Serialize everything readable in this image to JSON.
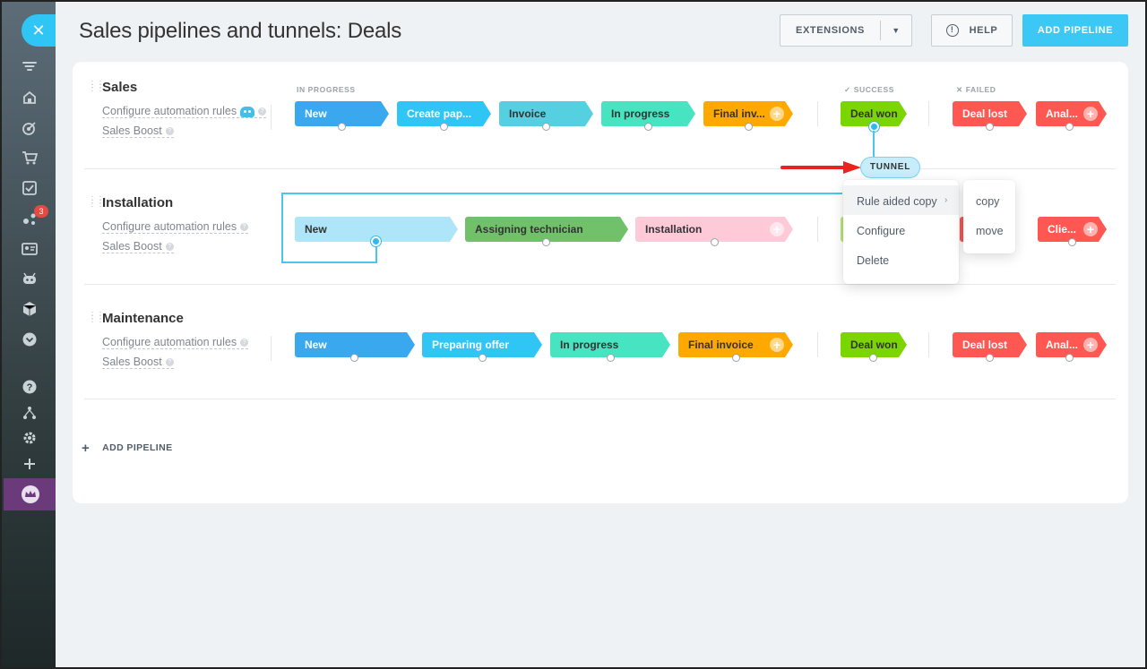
{
  "page": {
    "title": "Sales pipelines and tunnels: Deals"
  },
  "header": {
    "extensions_label": "EXTENSIONS",
    "help_label": "HELP",
    "add_pipeline_label": "ADD PIPELINE"
  },
  "sidebar": {
    "close_glyph": "✕",
    "badge_count": "3",
    "icons": [
      "filter-icon",
      "home-icon",
      "target-icon",
      "cart-icon",
      "checklist-icon",
      "network-icon",
      "contact-card-icon",
      "robot-icon",
      "box-icon",
      "chevron-down-icon",
      "help-icon",
      "sitemap-icon",
      "gear-icon",
      "plus-icon",
      "crown-icon"
    ]
  },
  "groups": {
    "in_progress": "IN PROGRESS",
    "success": "SUCCESS",
    "failed": "FAILED"
  },
  "pipelines": [
    {
      "title": "Sales",
      "automation_link": "Configure automation rules",
      "boost_link": "Sales Boost",
      "stages": [
        "New",
        "Create pap...",
        "Invoice",
        "In progress",
        "Final inv..."
      ],
      "success": "Deal won",
      "failed": [
        "Deal lost",
        "Anal..."
      ]
    },
    {
      "title": "Installation",
      "automation_link": "Configure automation rules",
      "boost_link": "Sales Boost",
      "stages": [
        "New",
        "Assigning technician",
        "Installation"
      ],
      "failed": [
        "Clie..."
      ]
    },
    {
      "title": "Maintenance",
      "automation_link": "Configure automation rules",
      "boost_link": "Sales Boost",
      "stages": [
        "New",
        "Preparing offer",
        "In progress",
        "Final invoice"
      ],
      "success": "Deal won",
      "failed": [
        "Deal lost",
        "Anal..."
      ]
    }
  ],
  "tunnel": {
    "label": "TUNNEL"
  },
  "context_menu": {
    "items": [
      "Rule aided copy",
      "Configure",
      "Delete"
    ],
    "submenu": [
      "copy",
      "move"
    ]
  },
  "add_pipeline_link": "ADD PIPELINE",
  "colors": {
    "accent": "#2fc6f6",
    "new": "#39a8ef",
    "create": "#2fc6f6",
    "invoice": "#55d0e0",
    "in_progress": "#47e4c2",
    "final": "#ffa900",
    "won": "#7bd500",
    "lost": "#ff5752",
    "assign": "#71c16a",
    "install_pink": "#ffcad8",
    "new_light": "#aee5f8"
  }
}
